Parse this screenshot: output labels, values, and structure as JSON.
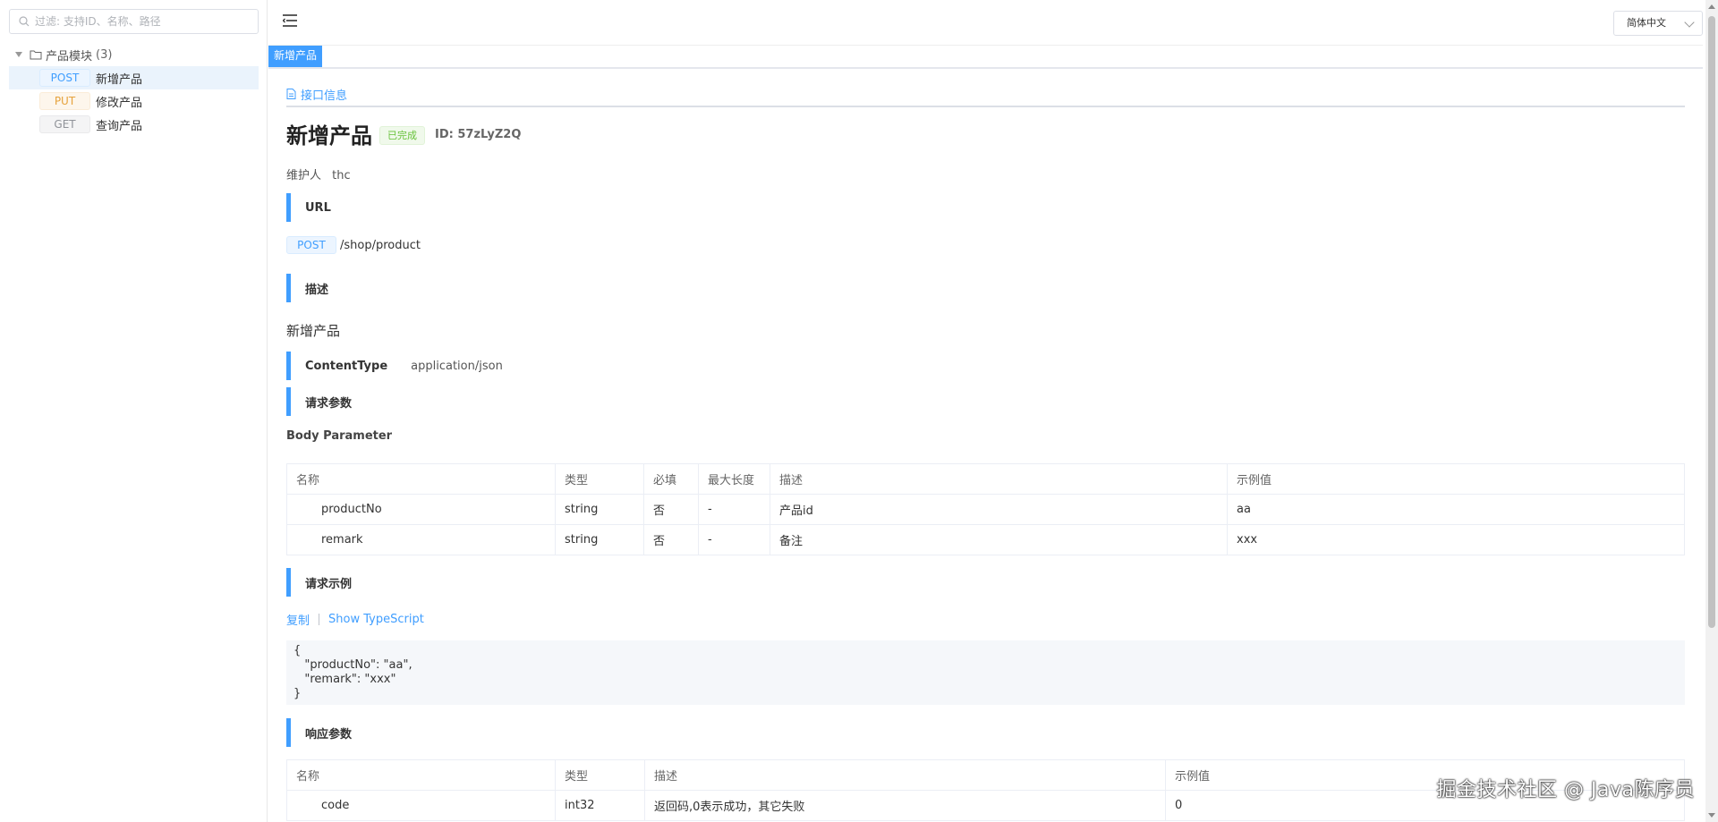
{
  "sidebar": {
    "search_placeholder": "过滤: 支持ID、名称、路径",
    "group": {
      "label": "产品模块",
      "count": "(3)"
    },
    "items": [
      {
        "method": "POST",
        "label": "新增产品",
        "active": true
      },
      {
        "method": "PUT",
        "label": "修改产品",
        "active": false
      },
      {
        "method": "GET",
        "label": "查询产品",
        "active": false
      }
    ]
  },
  "topbar": {
    "language": "简体中文"
  },
  "tabs": {
    "doc_tab": "新增产品",
    "info_tab": "接口信息"
  },
  "api": {
    "title": "新增产品",
    "status": "已完成",
    "id_text": "ID: 57zLyZ2Q",
    "maintainer_label": "维护人",
    "maintainer_value": "thc",
    "url_heading": "URL",
    "method": "POST",
    "path": "/shop/product",
    "desc_heading": "描述",
    "description": "新增产品",
    "content_type_label": "ContentType",
    "content_type_value": "application/json",
    "request_params_heading": "请求参数",
    "body_parameter_label": "Body Parameter",
    "request_example_heading": "请求示例",
    "copy_label": "复制",
    "show_ts_label": "Show TypeScript",
    "example_code": "{\n   \"productNo\": \"aa\",\n   \"remark\": \"xxx\"\n}",
    "response_params_heading": "响应参数"
  },
  "request_table": {
    "headers": [
      "名称",
      "类型",
      "必填",
      "最大长度",
      "描述",
      "示例值"
    ],
    "rows": [
      [
        "productNo",
        "string",
        "否",
        "-",
        "产品id",
        "aa"
      ],
      [
        "remark",
        "string",
        "否",
        "-",
        "备注",
        "xxx"
      ]
    ]
  },
  "response_table": {
    "headers": [
      "名称",
      "类型",
      "描述",
      "示例值"
    ],
    "rows": [
      [
        "code",
        "int32",
        "返回码,0表示成功，其它失败",
        "0"
      ]
    ]
  },
  "watermark": "掘金技术社区 @ Java陈序员",
  "colors": {
    "accent": "#409eff",
    "success": "#67c23a",
    "put": "#e6a23c"
  }
}
